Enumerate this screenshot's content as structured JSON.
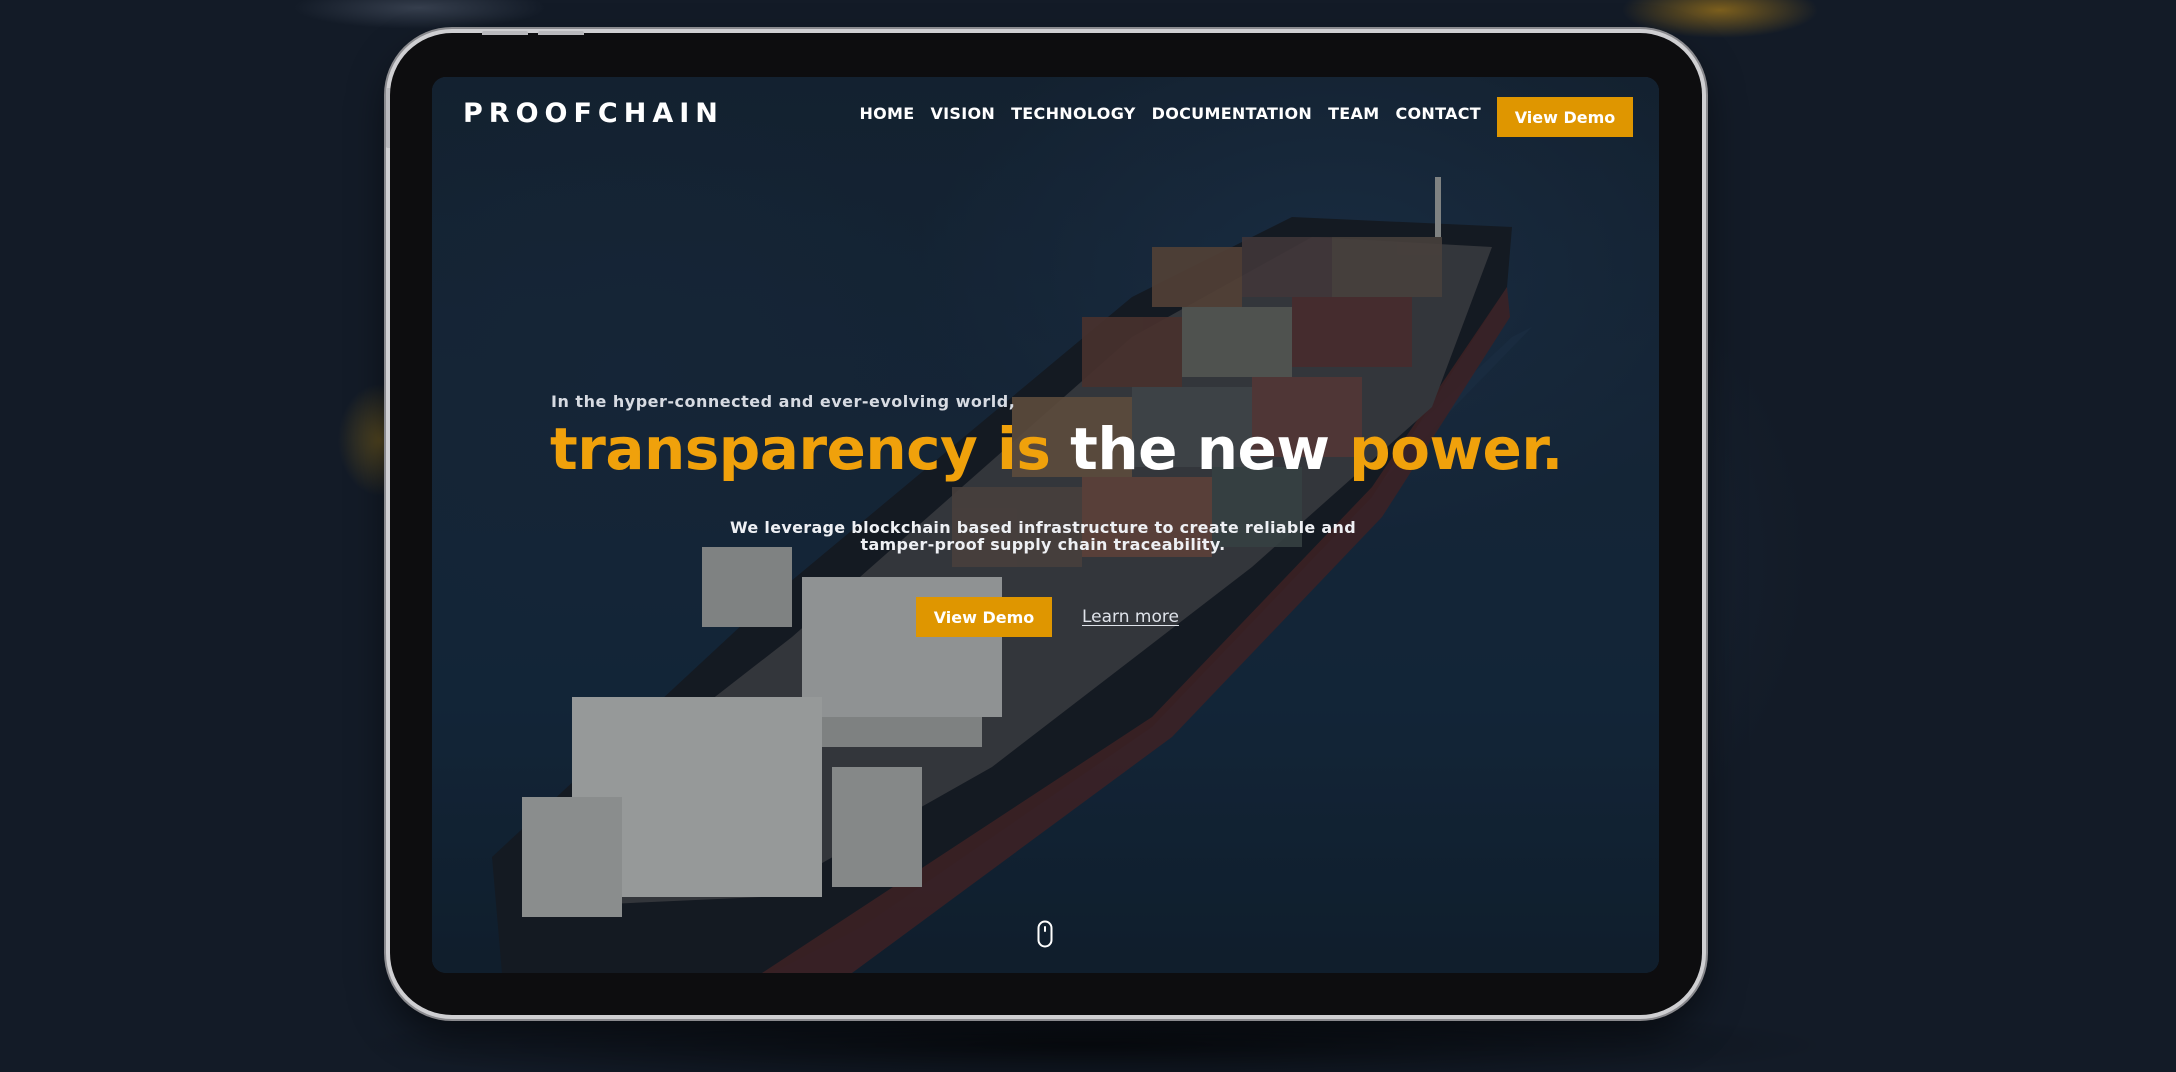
{
  "brand": {
    "logo_text": "PROOFCHAIN"
  },
  "nav": {
    "items": [
      "HOME",
      "VISION",
      "TECHNOLOGY",
      "DOCUMENTATION",
      "TEAM",
      "CONTACT"
    ],
    "cta_label": "View Demo"
  },
  "hero": {
    "intro": "In the hyper-connected and ever-evolving world,",
    "headline": {
      "part1": "transparency is ",
      "part2": "the new ",
      "part3": "power."
    },
    "subtext": "We leverage blockchain based infrastructure to create reliable and tamper-proof supply chain traceability.",
    "primary_cta": "View Demo",
    "secondary_cta": "Learn more"
  },
  "icons": {
    "scroll": "mouse-scroll-icon"
  },
  "colors": {
    "accent": "#df9600",
    "headline_accent": "#f0a10b",
    "text": "#ffffff",
    "background": "#141c28",
    "device_frame": "#cfcfd2"
  }
}
